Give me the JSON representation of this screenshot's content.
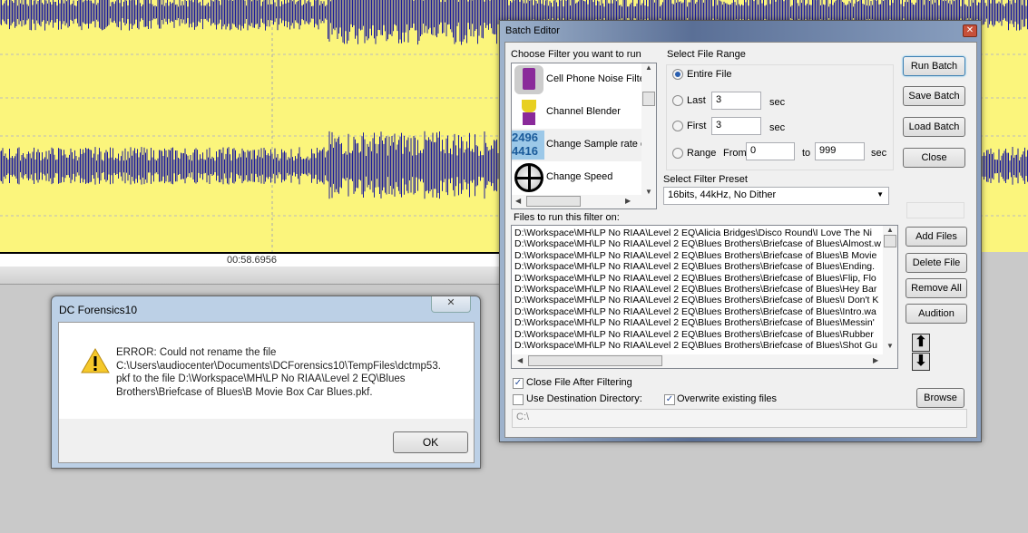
{
  "waveform": {
    "time_label": "00:58.6956",
    "background_color": "#fbf57c",
    "wave_color": "#1c1c9c"
  },
  "batch_editor": {
    "title": "Batch Editor",
    "filter_heading": "Choose Filter you want to run",
    "filters": [
      {
        "label": "Cell Phone Noise Filter",
        "icon": "cell-phone-icon"
      },
      {
        "label": "Channel Blender",
        "icon": "blender-icon"
      },
      {
        "label": "Change Sample rate or",
        "icon": "sample-rate-icon",
        "icon_text_top": "2496",
        "icon_text_bottom": "4416"
      },
      {
        "label": "Change Speed",
        "icon": "speed-wheel-icon"
      }
    ],
    "range_heading": "Select File Range",
    "range": {
      "entire": "Entire File",
      "last": "Last",
      "last_value": "3",
      "first": "First",
      "first_value": "3",
      "range": "Range",
      "from": "From",
      "from_value": "0",
      "to": "to",
      "to_value": "999",
      "sec": "sec",
      "selected": "entire"
    },
    "preset_heading": "Select Filter Preset",
    "preset_value": "16bits, 44kHz, No Dither",
    "buttons": {
      "run": "Run Batch",
      "save": "Save Batch",
      "load": "Load Batch",
      "close": "Close",
      "add": "Add Files",
      "delete": "Delete File",
      "remove_all": "Remove All",
      "audition": "Audition",
      "browse": "Browse"
    },
    "files_heading": "Files to run this filter on:",
    "files": [
      "D:\\Workspace\\MH\\LP No RIAA\\Level 2 EQ\\Alicia Bridges\\Disco Round\\I Love The Ni",
      "D:\\Workspace\\MH\\LP No RIAA\\Level 2 EQ\\Blues Brothers\\Briefcase of Blues\\Almost.w",
      "D:\\Workspace\\MH\\LP No RIAA\\Level 2 EQ\\Blues Brothers\\Briefcase of Blues\\B Movie",
      "D:\\Workspace\\MH\\LP No RIAA\\Level 2 EQ\\Blues Brothers\\Briefcase of Blues\\Ending.",
      "D:\\Workspace\\MH\\LP No RIAA\\Level 2 EQ\\Blues Brothers\\Briefcase of Blues\\Flip, Flo",
      "D:\\Workspace\\MH\\LP No RIAA\\Level 2 EQ\\Blues Brothers\\Briefcase of Blues\\Hey Bar",
      "D:\\Workspace\\MH\\LP No RIAA\\Level 2 EQ\\Blues Brothers\\Briefcase of Blues\\I Don't K",
      "D:\\Workspace\\MH\\LP No RIAA\\Level 2 EQ\\Blues Brothers\\Briefcase of Blues\\Intro.wa",
      "D:\\Workspace\\MH\\LP No RIAA\\Level 2 EQ\\Blues Brothers\\Briefcase of Blues\\Messin'",
      "D:\\Workspace\\MH\\LP No RIAA\\Level 2 EQ\\Blues Brothers\\Briefcase of Blues\\Rubber",
      "D:\\Workspace\\MH\\LP No RIAA\\Level 2 EQ\\Blues Brothers\\Briefcase of Blues\\Shot Gu"
    ],
    "close_after": {
      "label": "Close File After Filtering",
      "checked": true
    },
    "use_dest": {
      "label": "Use Destination Directory:",
      "checked": false
    },
    "overwrite": {
      "label": "Overwrite existing files",
      "checked": true
    },
    "dest_path": "C:\\"
  },
  "error_dialog": {
    "title": "DC Forensics10",
    "lines": [
      "ERROR: Could not rename the file",
      "C:\\Users\\audiocenter\\Documents\\DCForensics10\\TempFiles\\dctmp53.",
      "pkf to the file D:\\Workspace\\MH\\LP No RIAA\\Level 2 EQ\\Blues",
      "Brothers\\Briefcase of Blues\\B Movie Box Car Blues.pkf."
    ],
    "ok": "OK"
  }
}
